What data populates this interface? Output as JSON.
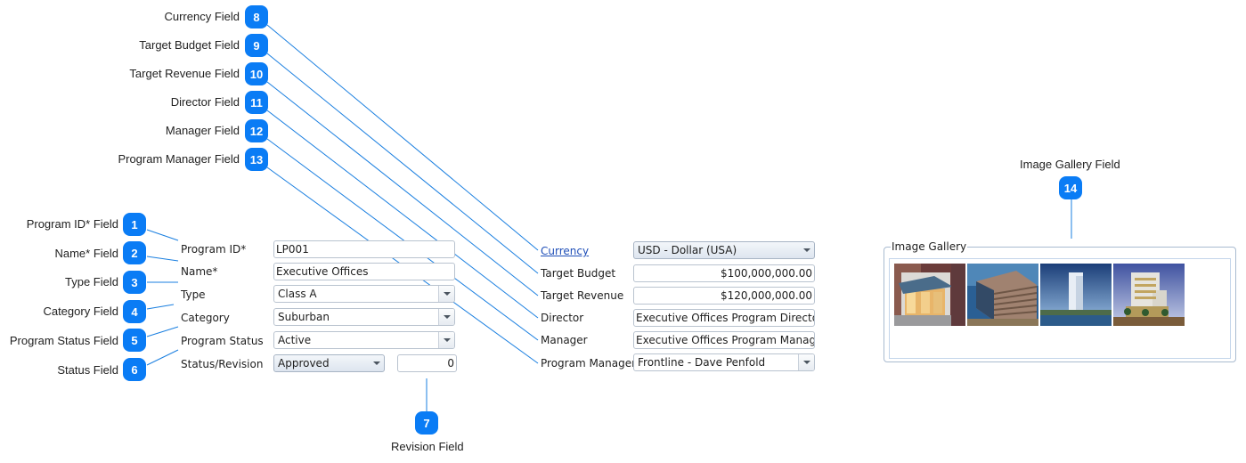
{
  "callouts": {
    "top": [
      {
        "number": "8",
        "label": "Currency Field"
      },
      {
        "number": "9",
        "label": "Target Budget Field"
      },
      {
        "number": "10",
        "label": "Target Revenue Field"
      },
      {
        "number": "11",
        "label": "Director Field"
      },
      {
        "number": "12",
        "label": "Manager Field"
      },
      {
        "number": "13",
        "label": "Program Manager Field"
      }
    ],
    "left": [
      {
        "number": "1",
        "label": "Program ID* Field"
      },
      {
        "number": "2",
        "label": "Name* Field"
      },
      {
        "number": "3",
        "label": "Type Field"
      },
      {
        "number": "4",
        "label": "Category Field"
      },
      {
        "number": "5",
        "label": "Program Status Field"
      },
      {
        "number": "6",
        "label": "Status Field"
      }
    ],
    "revision": {
      "number": "7",
      "label": "Revision Field"
    },
    "gallery": {
      "number": "14",
      "label": "Image Gallery Field"
    }
  },
  "form": {
    "left": [
      {
        "label": "Program ID*",
        "value": "LP001",
        "kind": "text"
      },
      {
        "label": "Name*",
        "value": "Executive Offices",
        "kind": "text"
      },
      {
        "label": "Type",
        "value": "Class A",
        "kind": "combo"
      },
      {
        "label": "Category",
        "value": "Suburban",
        "kind": "combo"
      },
      {
        "label": "Program Status",
        "value": "Active",
        "kind": "combo"
      },
      {
        "label": "Status/Revision",
        "status": "Approved",
        "revision": "0",
        "kind": "status"
      }
    ],
    "right": [
      {
        "label": "Currency",
        "value": "USD - Dollar (USA)",
        "kind": "combo",
        "link": true
      },
      {
        "label": "Target Budget",
        "value": "$100,000,000.00",
        "kind": "number"
      },
      {
        "label": "Target Revenue",
        "value": "$120,000,000.00",
        "kind": "number"
      },
      {
        "label": "Director",
        "value": "Executive Offices Program Director",
        "kind": "text"
      },
      {
        "label": "Manager",
        "value": "Executive Offices Program Manager",
        "kind": "text"
      },
      {
        "label": "Program Manager",
        "value": "Frontline - Dave Penfold",
        "kind": "combo"
      }
    ]
  },
  "gallery": {
    "title": "Image Gallery",
    "images": [
      {
        "name": "storefront-corner-building"
      },
      {
        "name": "office-building-blue-sky"
      },
      {
        "name": "residential-tower-waterfront"
      },
      {
        "name": "mid-rise-office-building"
      }
    ]
  },
  "colors": {
    "badge": "#0a7cf5",
    "callout_line": "#1a7fe0",
    "link": "#1f4fb8"
  }
}
